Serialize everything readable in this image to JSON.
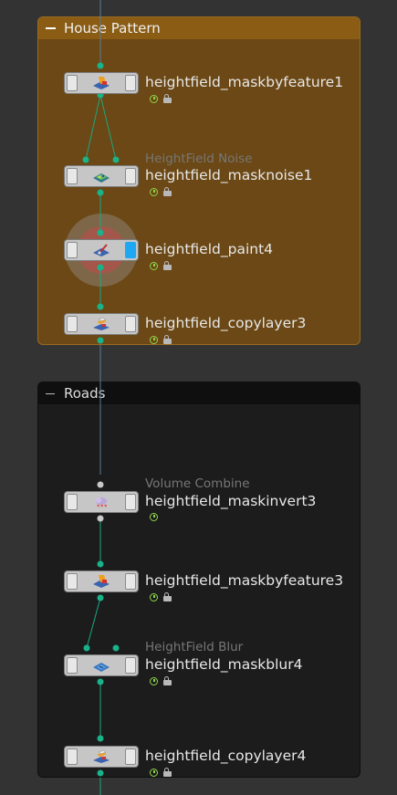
{
  "network_boxes": [
    {
      "id": "house",
      "title": "House Pattern",
      "color": "#8a5c14"
    },
    {
      "id": "roads",
      "title": "Roads",
      "color": "#0f0f0f"
    }
  ],
  "nodes": [
    {
      "id": "n1",
      "name": "heightfield_maskbyfeature1",
      "type_label": "",
      "icon": "maskbyfeature-icon",
      "display_flag": false
    },
    {
      "id": "n2",
      "name": "heightfield_masknoise1",
      "type_label": "HeightField Noise",
      "icon": "masknoise-icon",
      "display_flag": false
    },
    {
      "id": "n3",
      "name": "heightfield_paint4",
      "type_label": "",
      "icon": "paint-icon",
      "display_flag": true
    },
    {
      "id": "n4",
      "name": "heightfield_copylayer3",
      "type_label": "",
      "icon": "copylayer-icon",
      "display_flag": false
    },
    {
      "id": "n5",
      "name": "heightfield_maskinvert3",
      "type_label": "Volume Combine",
      "icon": "maskinvert-icon",
      "display_flag": false
    },
    {
      "id": "n6",
      "name": "heightfield_maskbyfeature3",
      "type_label": "",
      "icon": "maskbyfeature-icon",
      "display_flag": false
    },
    {
      "id": "n7",
      "name": "heightfield_maskblur4",
      "type_label": "HeightField Blur",
      "icon": "maskblur-icon",
      "display_flag": false
    },
    {
      "id": "n8",
      "name": "heightfield_copylayer4",
      "type_label": "",
      "icon": "copylayer-icon",
      "display_flag": false
    }
  ],
  "colors": {
    "background": "#333333",
    "house_box": "#6b4815",
    "roads_box": "#1c1c1c",
    "wire": "#1aa882",
    "connector": "#19b38a",
    "display_flag": "#1ea7f2"
  }
}
